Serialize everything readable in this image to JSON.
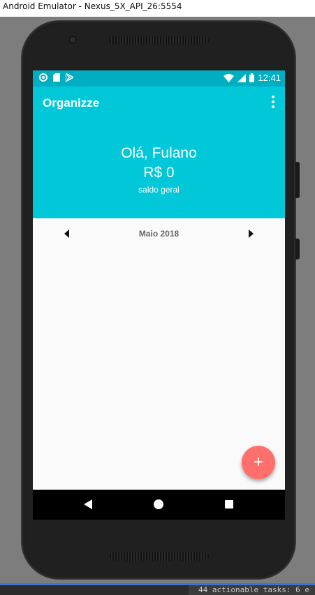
{
  "window": {
    "title": "Android Emulator - Nexus_5X_API_26:5554"
  },
  "status_bar": {
    "time": "12:41",
    "left_icons": [
      "circle-notification-icon",
      "sd-card-icon",
      "playstore-icon"
    ],
    "right_icons": [
      "wifi-icon",
      "signal-icon",
      "battery-icon"
    ]
  },
  "toolbar": {
    "title": "Organizze",
    "menu_icon": "overflow-menu-icon"
  },
  "header": {
    "greeting": "Olá, Fulano",
    "balance": "R$ 0",
    "balance_label": "saldo geral"
  },
  "month_selector": {
    "label": "Maio 2018",
    "prev_icon": "chevron-left-icon",
    "next_icon": "chevron-right-icon"
  },
  "fab": {
    "label": "+"
  },
  "nav": {
    "back_icon": "back-icon",
    "home_icon": "home-icon",
    "recent_icon": "recent-apps-icon"
  },
  "console": {
    "text": "44 actionable tasks: 6 e"
  },
  "colors": {
    "primary": "#00c8d8",
    "status_bar": "#00aec2",
    "fab": "#ff6f6c",
    "background": "#fafafa"
  }
}
